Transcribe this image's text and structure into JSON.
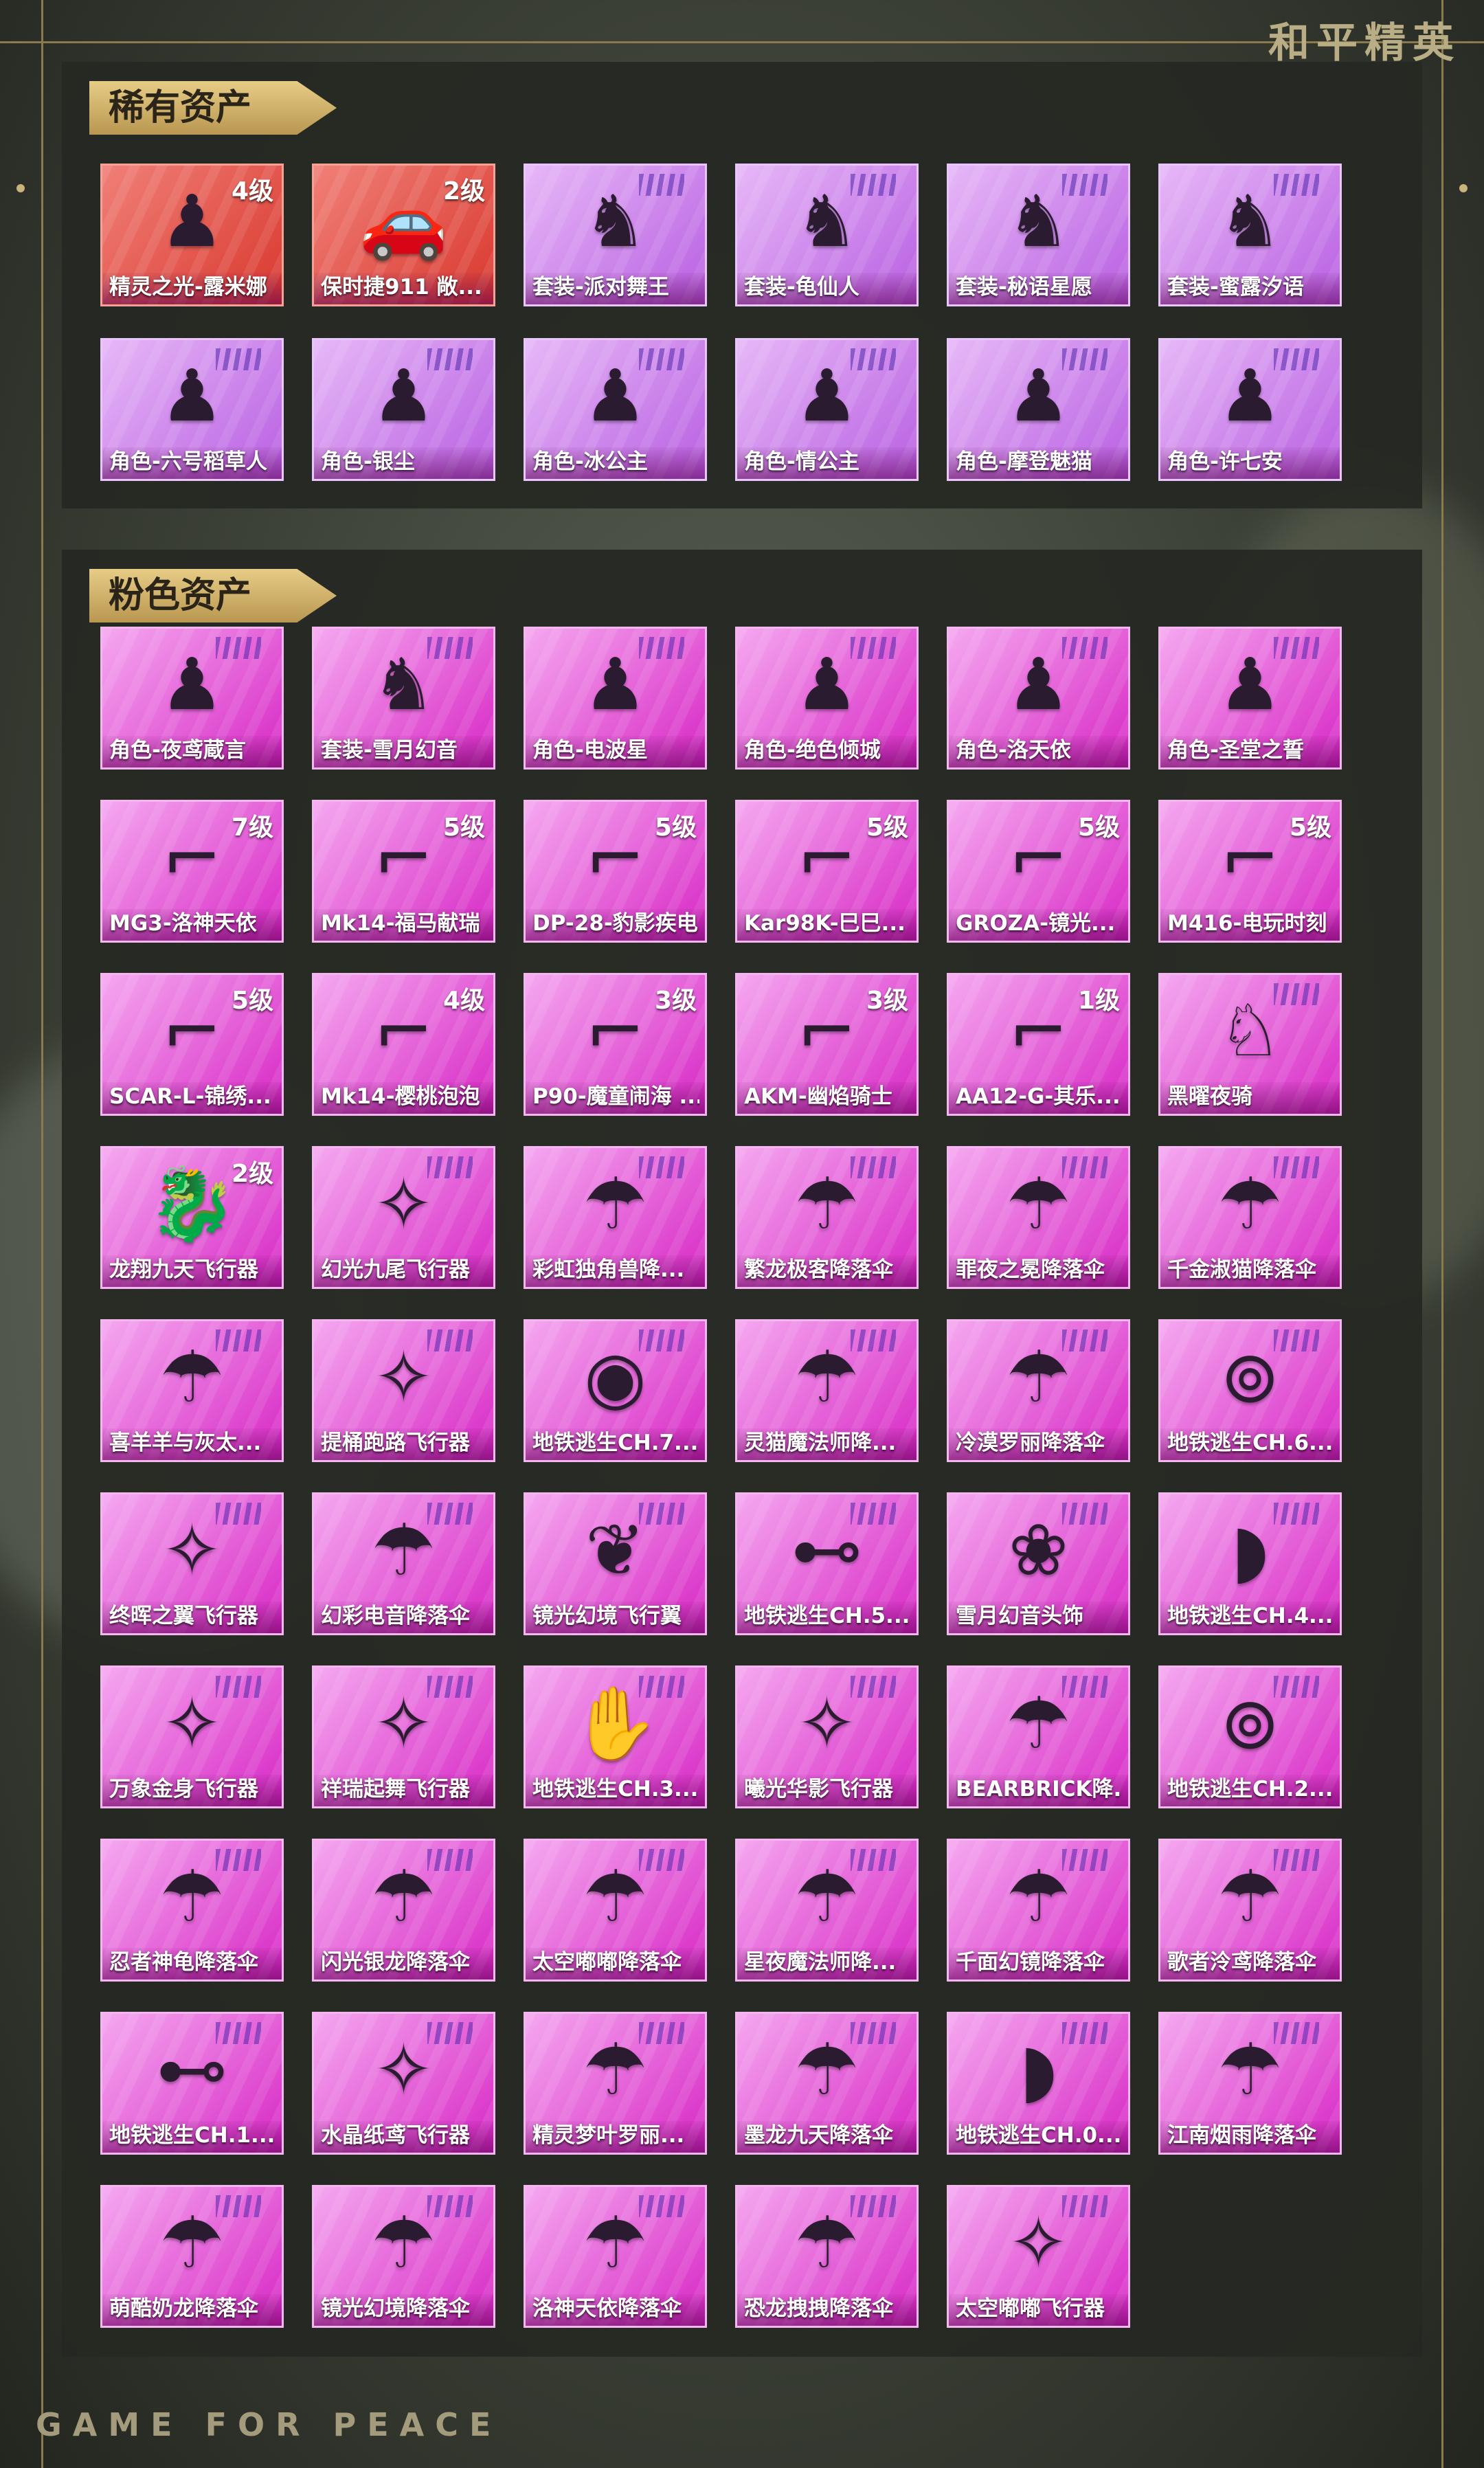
{
  "brand": "和平精英",
  "footer_brand": "GAME FOR PEACE",
  "sections": [
    {
      "title": "稀有资产",
      "items": [
        {
          "name": "精灵之光-露米娜",
          "level": "4级",
          "color": "red",
          "icon": "character-figure-icon"
        },
        {
          "name": "保时捷911 敞...",
          "level": "2级",
          "color": "red",
          "icon": "car-icon"
        },
        {
          "name": "套装-派对舞王",
          "level": "",
          "color": "purple",
          "icon": "outfit-icon"
        },
        {
          "name": "套装-龟仙人",
          "level": "",
          "color": "purple",
          "icon": "outfit-icon"
        },
        {
          "name": "套装-秘语星愿",
          "level": "",
          "color": "purple",
          "icon": "outfit-icon"
        },
        {
          "name": "套装-蜜露汐语",
          "level": "",
          "color": "purple",
          "icon": "outfit-icon"
        },
        {
          "name": "角色-六号稻草人",
          "level": "",
          "color": "purple",
          "icon": "character-figure-icon"
        },
        {
          "name": "角色-银尘",
          "level": "",
          "color": "purple",
          "icon": "character-figure-icon"
        },
        {
          "name": "角色-冰公主",
          "level": "",
          "color": "purple",
          "icon": "character-figure-icon"
        },
        {
          "name": "角色-情公主",
          "level": "",
          "color": "purple",
          "icon": "character-figure-icon"
        },
        {
          "name": "角色-摩登魅猫",
          "level": "",
          "color": "purple",
          "icon": "character-figure-icon"
        },
        {
          "name": "角色-许七安",
          "level": "",
          "color": "purple",
          "icon": "character-figure-icon"
        }
      ]
    },
    {
      "title": "粉色资产",
      "items": [
        {
          "name": "角色-夜鸢蔵言",
          "level": "",
          "color": "pink",
          "icon": "character-figure-icon"
        },
        {
          "name": "套装-雪月幻音",
          "level": "",
          "color": "pink",
          "icon": "outfit-icon"
        },
        {
          "name": "角色-电波星",
          "level": "",
          "color": "pink",
          "icon": "character-figure-icon"
        },
        {
          "name": "角色-绝色倾城",
          "level": "",
          "color": "pink",
          "icon": "character-figure-icon"
        },
        {
          "name": "角色-洛天依",
          "level": "",
          "color": "pink",
          "icon": "character-figure-icon"
        },
        {
          "name": "角色-圣堂之誓",
          "level": "",
          "color": "pink",
          "icon": "character-figure-icon"
        },
        {
          "name": "MG3-洛神天依",
          "level": "7级",
          "color": "pink",
          "icon": "gun-icon"
        },
        {
          "name": "Mk14-福马献瑞",
          "level": "5级",
          "color": "pink",
          "icon": "gun-icon"
        },
        {
          "name": "DP-28-豹影疾电",
          "level": "5级",
          "color": "pink",
          "icon": "gun-icon"
        },
        {
          "name": "Kar98K-巳巳...",
          "level": "5级",
          "color": "pink",
          "icon": "gun-icon"
        },
        {
          "name": "GROZA-镜光...",
          "level": "5级",
          "color": "pink",
          "icon": "gun-icon"
        },
        {
          "name": "M416-电玩时刻",
          "level": "5级",
          "color": "pink",
          "icon": "gun-icon"
        },
        {
          "name": "SCAR-L-锦绣...",
          "level": "5级",
          "color": "pink",
          "icon": "gun-icon"
        },
        {
          "name": "Mk14-樱桃泡泡",
          "level": "4级",
          "color": "pink",
          "icon": "gun-icon"
        },
        {
          "name": "P90-魔童闹海 ...",
          "level": "3级",
          "color": "pink",
          "icon": "gun-icon"
        },
        {
          "name": "AKM-幽焰骑士",
          "level": "3级",
          "color": "pink",
          "icon": "gun-icon"
        },
        {
          "name": "AA12-G-其乐...",
          "level": "1级",
          "color": "pink",
          "icon": "gun-icon"
        },
        {
          "name": "黑曜夜骑",
          "level": "",
          "color": "pink",
          "icon": "horse-mount-icon"
        },
        {
          "name": "龙翔九天飞行器",
          "level": "2级",
          "color": "pink",
          "icon": "dragon-glider-icon"
        },
        {
          "name": "幻光九尾飞行器",
          "level": "",
          "color": "pink",
          "icon": "glider-icon"
        },
        {
          "name": "彩虹独角兽降...",
          "level": "",
          "color": "pink",
          "icon": "parachute-icon"
        },
        {
          "name": "繁龙极客降落伞",
          "level": "",
          "color": "pink",
          "icon": "parachute-icon"
        },
        {
          "name": "罪夜之冕降落伞",
          "level": "",
          "color": "pink",
          "icon": "parachute-icon"
        },
        {
          "name": "千金淑猫降落伞",
          "level": "",
          "color": "pink",
          "icon": "parachute-icon"
        },
        {
          "name": "喜羊羊与灰太...",
          "level": "",
          "color": "pink",
          "icon": "parachute-icon"
        },
        {
          "name": "提桶跑路飞行器",
          "level": "",
          "color": "pink",
          "icon": "glider-icon"
        },
        {
          "name": "地铁逃生CH.7...",
          "level": "",
          "color": "pink",
          "icon": "goggles-icon"
        },
        {
          "name": "灵猫魔法师降...",
          "level": "",
          "color": "pink",
          "icon": "parachute-icon"
        },
        {
          "name": "冷漠罗丽降落伞",
          "level": "",
          "color": "pink",
          "icon": "parachute-icon"
        },
        {
          "name": "地铁逃生CH.6...",
          "level": "",
          "color": "pink",
          "icon": "gas-mask-icon"
        },
        {
          "name": "终晖之翼飞行器",
          "level": "",
          "color": "pink",
          "icon": "glider-icon"
        },
        {
          "name": "幻彩电音降落伞",
          "level": "",
          "color": "pink",
          "icon": "parachute-icon"
        },
        {
          "name": "镜光幻境飞行翼",
          "level": "",
          "color": "pink",
          "icon": "wings-icon"
        },
        {
          "name": "地铁逃生CH.5...",
          "level": "",
          "color": "pink",
          "icon": "sunglasses-icon"
        },
        {
          "name": "雪月幻音头饰",
          "level": "",
          "color": "pink",
          "icon": "headwear-icon"
        },
        {
          "name": "地铁逃生CH.4...",
          "level": "",
          "color": "pink",
          "icon": "face-mask-icon"
        },
        {
          "name": "万象金身飞行器",
          "level": "",
          "color": "pink",
          "icon": "glider-icon"
        },
        {
          "name": "祥瑞起舞飞行器",
          "level": "",
          "color": "pink",
          "icon": "glider-icon"
        },
        {
          "name": "地铁逃生CH.3...",
          "level": "",
          "color": "pink",
          "icon": "gloves-icon"
        },
        {
          "name": "曦光华影飞行器",
          "level": "",
          "color": "pink",
          "icon": "glider-icon"
        },
        {
          "name": "BEARBRICK降...",
          "level": "",
          "color": "pink",
          "icon": "parachute-icon"
        },
        {
          "name": "地铁逃生CH.2...",
          "level": "",
          "color": "pink",
          "icon": "gas-mask-icon"
        },
        {
          "name": "忍者神龟降落伞",
          "level": "",
          "color": "pink",
          "icon": "parachute-icon"
        },
        {
          "name": "闪光银龙降落伞",
          "level": "",
          "color": "pink",
          "icon": "parachute-icon"
        },
        {
          "name": "太空嘟嘟降落伞",
          "level": "",
          "color": "pink",
          "icon": "parachute-icon"
        },
        {
          "name": "星夜魔法师降...",
          "level": "",
          "color": "pink",
          "icon": "parachute-icon"
        },
        {
          "name": "千面幻镜降落伞",
          "level": "",
          "color": "pink",
          "icon": "parachute-icon"
        },
        {
          "name": "歌者泠鸢降落伞",
          "level": "",
          "color": "pink",
          "icon": "parachute-icon"
        },
        {
          "name": "地铁逃生CH.1...",
          "level": "",
          "color": "pink",
          "icon": "sunglasses-icon"
        },
        {
          "name": "水晶纸鸢飞行器",
          "level": "",
          "color": "pink",
          "icon": "glider-icon"
        },
        {
          "name": "精灵梦叶罗丽...",
          "level": "",
          "color": "pink",
          "icon": "parachute-icon"
        },
        {
          "name": "墨龙九天降落伞",
          "level": "",
          "color": "pink",
          "icon": "parachute-icon"
        },
        {
          "name": "地铁逃生CH.0...",
          "level": "",
          "color": "pink",
          "icon": "face-mask-icon"
        },
        {
          "name": "江南烟雨降落伞",
          "level": "",
          "color": "pink",
          "icon": "parachute-icon"
        },
        {
          "name": "萌酷奶龙降落伞",
          "level": "",
          "color": "pink",
          "icon": "parachute-icon"
        },
        {
          "name": "镜光幻境降落伞",
          "level": "",
          "color": "pink",
          "icon": "parachute-icon"
        },
        {
          "name": "洛神天依降落伞",
          "level": "",
          "color": "pink",
          "icon": "parachute-icon"
        },
        {
          "name": "恐龙拽拽降落伞",
          "level": "",
          "color": "pink",
          "icon": "parachute-icon"
        },
        {
          "name": "太空嘟嘟飞行器",
          "level": "",
          "color": "pink",
          "icon": "glider-icon"
        }
      ]
    }
  ]
}
